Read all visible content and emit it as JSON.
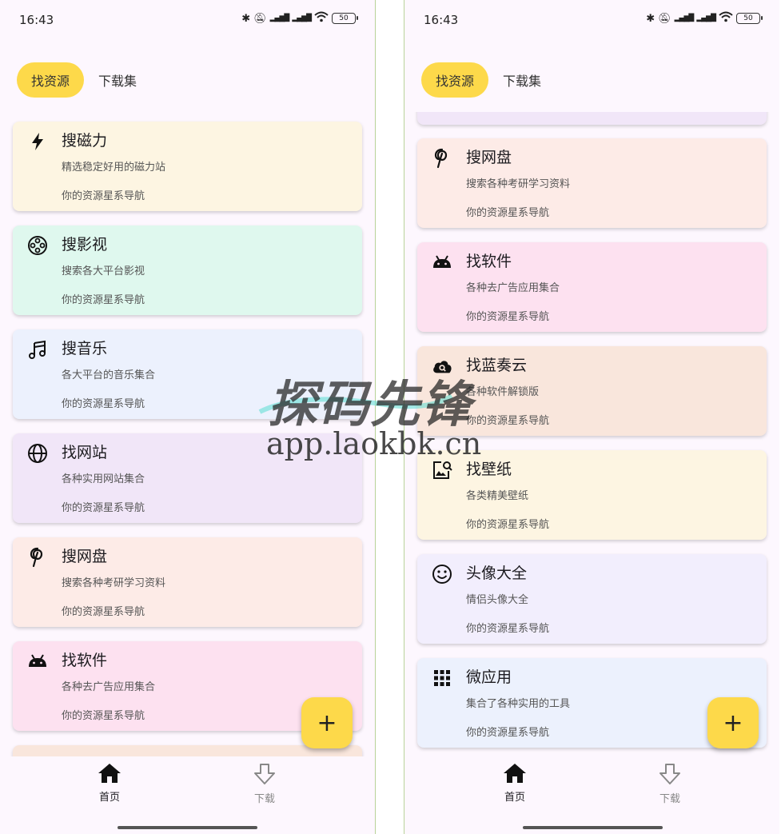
{
  "status": {
    "time": "16:43",
    "battery": "50"
  },
  "tabs": [
    {
      "label": "找资源"
    },
    {
      "label": "下载集"
    }
  ],
  "card_colors": {
    "yellow": "#fdf5e2",
    "green": "#dff8ee",
    "blue": "#ecf1fd",
    "purple": "#f1e6f8",
    "peach": "#fdebe7",
    "pink": "#fde1f0",
    "tan": "#f9e6dc",
    "lavender": "#f2eefd"
  },
  "left_screen": {
    "cards": [
      {
        "title": "搜磁力",
        "desc": "精选稳定好用的磁力站",
        "footer": "你的资源星系导航",
        "icon": "bolt-icon"
      },
      {
        "title": "搜影视",
        "desc": "搜索各大平台影视",
        "footer": "你的资源星系导航",
        "icon": "film-reel-icon"
      },
      {
        "title": "搜音乐",
        "desc": "各大平台的音乐集合",
        "footer": "你的资源星系导航",
        "icon": "music-note-icon"
      },
      {
        "title": "找网站",
        "desc": "各种实用网站集合",
        "footer": "你的资源星系导航",
        "icon": "globe-icon"
      },
      {
        "title": "搜网盘",
        "desc": "搜索各种考研学习资料",
        "footer": "你的资源星系导航",
        "icon": "pinterest-icon"
      },
      {
        "title": "找软件",
        "desc": "各种去广告应用集合",
        "footer": "你的资源星系导航",
        "icon": "android-icon"
      }
    ]
  },
  "right_screen": {
    "cards": [
      {
        "title": "搜网盘",
        "desc": "搜索各种考研学习资料",
        "footer": "你的资源星系导航",
        "icon": "pinterest-icon"
      },
      {
        "title": "找软件",
        "desc": "各种去广告应用集合",
        "footer": "你的资源星系导航",
        "icon": "android-icon"
      },
      {
        "title": "找蓝奏云",
        "desc": "各种软件解锁版",
        "footer": "你的资源星系导航",
        "icon": "cloud-search-icon"
      },
      {
        "title": "找壁纸",
        "desc": "各类精美壁纸",
        "footer": "你的资源星系导航",
        "icon": "image-search-icon"
      },
      {
        "title": "头像大全",
        "desc": "情侣头像大全",
        "footer": "你的资源星系导航",
        "icon": "smiley-icon"
      },
      {
        "title": "微应用",
        "desc": "集合了各种实用的工具",
        "footer": "你的资源星系导航",
        "icon": "apps-grid-icon"
      }
    ]
  },
  "fab": {
    "label": "+"
  },
  "bottom_nav": [
    {
      "label": "首页",
      "icon": "home-icon"
    },
    {
      "label": "下载",
      "icon": "download-arrow-icon"
    }
  ],
  "watermark": {
    "text": "探码先锋",
    "url": "app.laokbk.cn"
  }
}
